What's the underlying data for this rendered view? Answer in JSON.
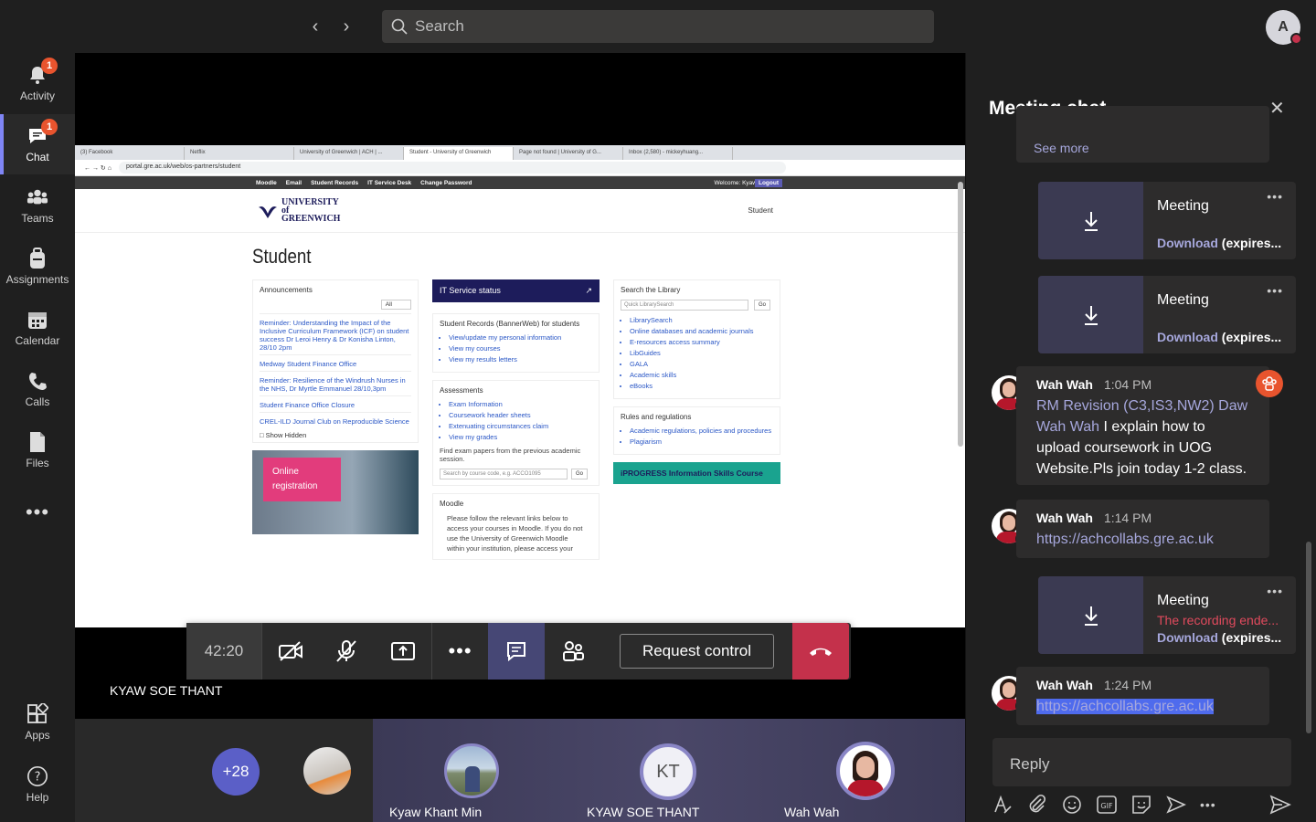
{
  "top": {
    "search_placeholder": "Search",
    "account_initial": "A"
  },
  "rail": [
    {
      "label": "Activity",
      "icon": "bell-icon",
      "badge": "1"
    },
    {
      "label": "Chat",
      "icon": "chat-icon",
      "badge": "1",
      "active": true
    },
    {
      "label": "Teams",
      "icon": "teams-icon"
    },
    {
      "label": "Assignments",
      "icon": "backpack-icon"
    },
    {
      "label": "Calendar",
      "icon": "calendar-icon"
    },
    {
      "label": "Calls",
      "icon": "phone-icon"
    },
    {
      "label": "Files",
      "icon": "file-icon"
    },
    {
      "label": "...",
      "icon": "more-icon"
    },
    {
      "label": "Apps",
      "icon": "apps-icon"
    },
    {
      "label": "Help",
      "icon": "help-icon"
    }
  ],
  "shared": {
    "tabs": [
      "(3) Facebook",
      "Netflix",
      "University of Greenwich | ACH | ...",
      "Student - University of Greenwich",
      "Page not found | University of G...",
      "Inbox (2,580) - mickeyhuang..."
    ],
    "url": "portal.gre.ac.uk/web/os-partners/student",
    "menu": [
      "Moodle",
      "Email",
      "Student Records",
      "IT Service Desk",
      "Change Password"
    ],
    "welcome": "Welcome: Kyaw",
    "logout": "Logout",
    "logo": "UNIVERSITY of GREENWICH",
    "header_right": "Student",
    "page_title": "Student",
    "announcements_title": "Announcements",
    "announcements_filter": "All",
    "announcements": [
      "Reminder: Understanding the Impact of the Inclusive Curriculum Framework (ICF) on student success Dr Leroi Henry & Dr Konisha Linton, 28/10 2pm",
      "Medway Student Finance Office",
      "Reminder: Resilience of the Windrush Nurses in the NHS, Dr Myrtle Emmanuel 28/10,3pm",
      "Student Finance Office Closure",
      "CREL-ILD Journal Club on Reproducible Science"
    ],
    "show_hidden": "Show Hidden",
    "online_reg": "Online registration",
    "it_status": "IT Service status",
    "records_title": "Student Records (BannerWeb) for students",
    "records_links": [
      "View/update my personal information",
      "View my courses",
      "View my results letters"
    ],
    "assess_title": "Assessments",
    "assess_links": [
      "Exam Information",
      "Coursework header sheets",
      "Extenuating circumstances claim",
      "View my grades"
    ],
    "assess_text": "Find exam papers from the previous academic session.",
    "assess_placeholder": "Search by course code, e.g. ACCO1095",
    "go": "Go",
    "moodle_title": "Moodle",
    "moodle_text": "Please follow the relevant links below to access your courses in Moodle. If you do not use the University of Greenwich Moodle within your institution, please access your",
    "library_title": "Search the Library",
    "library_placeholder": "Quick LibrarySearch",
    "library_links": [
      "LibrarySearch",
      "Online databases and academic journals",
      "E-resources access summary",
      "LibGuides",
      "GALA",
      "Academic skills",
      "eBooks"
    ],
    "rules_title": "Rules and regulations",
    "rules_links": [
      "Academic regulations, policies and procedures",
      "Plagiarism"
    ],
    "iprogress": "iPROGRESS Information Skills Course"
  },
  "call": {
    "timer": "42:20",
    "request_control": "Request control",
    "presenter": "KYAW SOE THANT"
  },
  "roster": {
    "more": "+28",
    "p1": "Kyaw Khant Min",
    "p2_initials": "KT",
    "p2": "KYAW SOE THANT",
    "p3": "Wah Wah"
  },
  "chat": {
    "title": "Meeting chat",
    "see_more": "See more",
    "rec1": {
      "title": "Meeting",
      "download": "Download",
      "expires": "(expires..."
    },
    "rec2": {
      "title": "Meeting",
      "download": "Download",
      "expires": "(expires..."
    },
    "msg1": {
      "author": "Wah Wah",
      "time": "1:04 PM",
      "mention": "RM Revision (C3,IS3,NW2) Daw Wah Wah",
      "text": " I explain how to upload coursework in UOG Website.Pls join today 1-2 class."
    },
    "msg2": {
      "author": "Wah Wah",
      "time": "1:14 PM",
      "link": "https://achcollabs.gre.ac.uk"
    },
    "rec3": {
      "title": "Meeting",
      "sub": "The recording ende...",
      "download": "Download",
      "expires": "(expires..."
    },
    "msg3": {
      "author": "Wah Wah",
      "time": "1:24 PM",
      "link": "https://achcollabs.gre.ac.uk"
    },
    "reply_placeholder": "Reply"
  },
  "colors": {
    "accent": "#5b5fc7",
    "hangup": "#c4314b",
    "link": "#a6a7dc",
    "badge": "#e8542e"
  }
}
